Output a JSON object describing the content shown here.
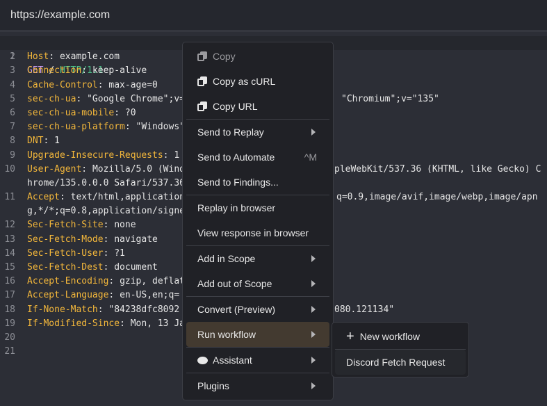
{
  "header": {
    "url": "https://example.com"
  },
  "request": {
    "method": "GET",
    "path": "/",
    "version": "HTTP/1.1",
    "headers": [
      {
        "n": "2",
        "k": "Host",
        "v": "example.com"
      },
      {
        "n": "3",
        "k": "Connection",
        "v": "keep-alive"
      },
      {
        "n": "4",
        "k": "Cache-Control",
        "v": "max-age=0"
      },
      {
        "n": "5",
        "k": "sec-ch-ua",
        "v": "\"Google Chrome\";v=",
        "tail": "\"Chromium\";v=\"135\""
      },
      {
        "n": "6",
        "k": "sec-ch-ua-mobile",
        "v": "?0"
      },
      {
        "n": "7",
        "k": "sec-ch-ua-platform",
        "v": "\"Windows\""
      },
      {
        "n": "8",
        "k": "DNT",
        "v": "1"
      },
      {
        "n": "9",
        "k": "Upgrade-Insecure-Requests",
        "v": "1"
      },
      {
        "n": "10",
        "k": "User-Agent",
        "v": "Mozilla/5.0 (Wind",
        "tail": "pleWebKit/537.36 (KHTML, like Gecko) C",
        "wrap": "hrome/135.0.0.0 Safari/537.36"
      },
      {
        "n": "11",
        "k": "Accept",
        "v": "text/html,application",
        "tail": "q=0.9,image/avif,image/webp,image/apn",
        "wrap": "g,*/*;q=0.8,application/signe"
      },
      {
        "n": "12",
        "k": "Sec-Fetch-Site",
        "v": "none"
      },
      {
        "n": "13",
        "k": "Sec-Fetch-Mode",
        "v": "navigate"
      },
      {
        "n": "14",
        "k": "Sec-Fetch-User",
        "v": "?1"
      },
      {
        "n": "15",
        "k": "Sec-Fetch-Dest",
        "v": "document"
      },
      {
        "n": "16",
        "k": "Accept-Encoding",
        "v": "gzip, deflat"
      },
      {
        "n": "17",
        "k": "Accept-Language",
        "v": "en-US,en;q="
      },
      {
        "n": "18",
        "k": "If-None-Match",
        "v": "\"84238dfc8092",
        "tail": "080.121134\""
      },
      {
        "n": "19",
        "k": "If-Modified-Since",
        "v": "Mon, 13 Ja"
      }
    ],
    "empty_lines": [
      "20",
      "21"
    ]
  },
  "menu": {
    "copy": "Copy",
    "copy_curl": "Copy as cURL",
    "copy_url": "Copy URL",
    "send_replay": "Send to Replay",
    "send_automate": "Send to Automate",
    "send_automate_shortcut": "^M",
    "send_findings": "Send to Findings...",
    "replay_browser": "Replay in browser",
    "view_response": "View response in browser",
    "add_scope": "Add in Scope",
    "add_out_scope": "Add out of Scope",
    "convert": "Convert (Preview)",
    "run_workflow": "Run workflow",
    "assistant": "Assistant",
    "plugins": "Plugins"
  },
  "submenu": {
    "new_workflow": "New workflow",
    "discord": "Discord Fetch Request"
  }
}
